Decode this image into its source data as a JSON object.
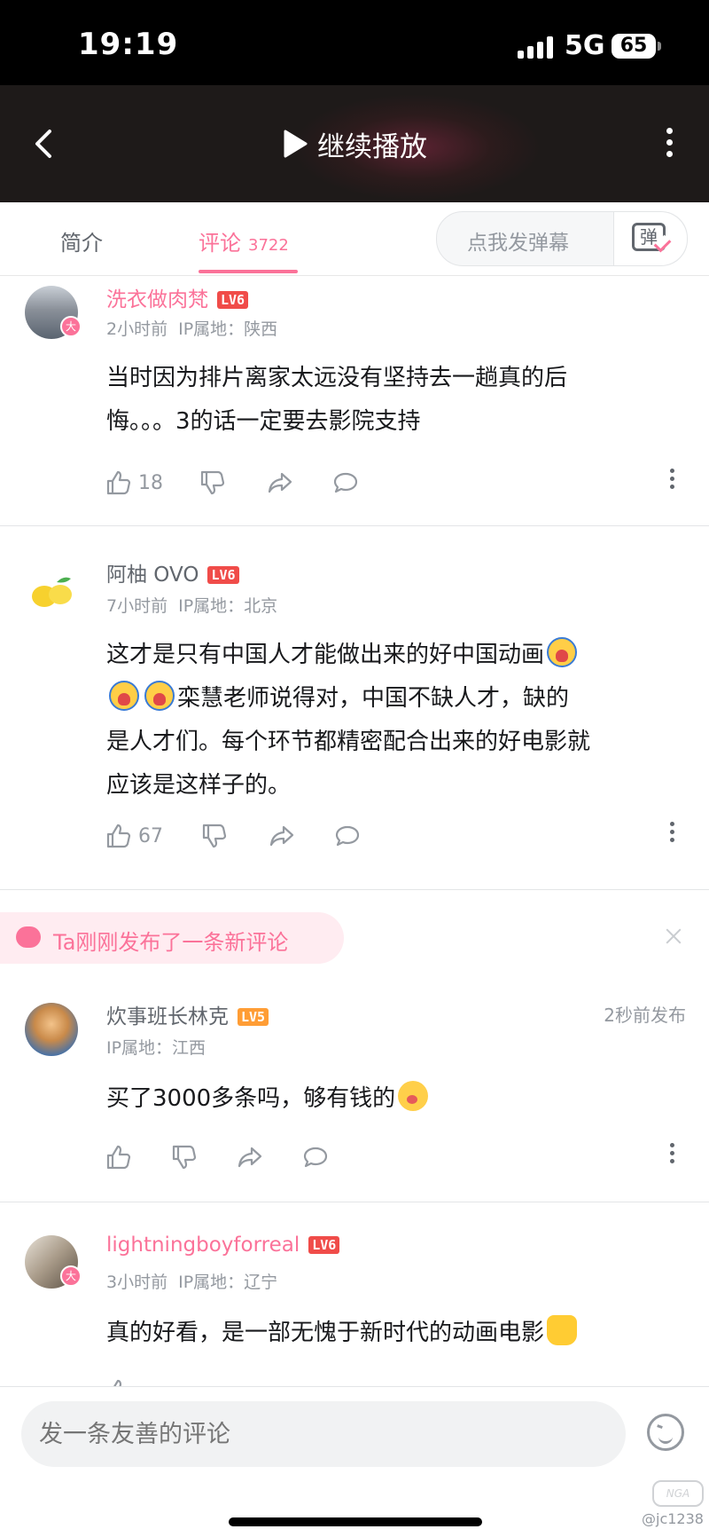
{
  "status_bar": {
    "time": "19:19",
    "network": "5G",
    "battery": "65"
  },
  "header": {
    "play_label": "继续播放"
  },
  "tabs": {
    "intro": "简介",
    "comments": "评论",
    "comment_count": "3722"
  },
  "danmaku": {
    "placeholder": "点我发弹幕",
    "icon_text": "弹"
  },
  "comments": [
    {
      "username": "洗衣做肉梵",
      "level": "LV6",
      "avatar_badge": "大",
      "time": "2小时前",
      "ip": "IP属地：陕西",
      "lines": [
        "当时因为排片离家太远没有坚持去一趟真的后",
        "悔。。。3的话一定要去影院支持"
      ],
      "likes": "18"
    },
    {
      "username": "阿柚 OVO",
      "level": "LV6",
      "time": "7小时前",
      "ip": "IP属地：北京",
      "line1": "这才是只有中国人才能做出来的好中国动画",
      "line2": "栾慧老师说得对，中国不缺人才，缺的",
      "line3": "是人才们。每个环节都精密配合出来的好电影就",
      "line4": "应该是这样子的。",
      "likes": "67"
    },
    {
      "username": "炊事班长林克",
      "level": "LV5",
      "posted": "2秒前发布",
      "ip": "IP属地：江西",
      "text": "买了3000多条吗，够有钱的"
    },
    {
      "username": "lightningboyforreal",
      "level": "LV6",
      "avatar_badge": "大",
      "time": "3小时前",
      "ip": "IP属地：辽宁",
      "text": "真的好看，是一部无愧于新时代的动画电影"
    }
  ],
  "notice": {
    "label": "Ta刚刚发布了一条新评论"
  },
  "input": {
    "placeholder": "发一条友善的评论"
  },
  "watermark": {
    "handle": "@jc1238",
    "logo": "NGA"
  },
  "colors": {
    "accent": "#fb7299",
    "level6": "#f04c49",
    "level5": "#ff9d35"
  }
}
